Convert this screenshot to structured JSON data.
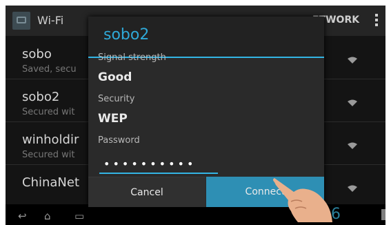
{
  "action_bar": {
    "title": "Wi-Fi",
    "add_network_label": "ETWORK",
    "overflow_icon": "overflow-menu-icon"
  },
  "networks": [
    {
      "ssid": "sobo",
      "status": "Saved, secu"
    },
    {
      "ssid": "sobo2",
      "status": "Secured wit"
    },
    {
      "ssid": "winholdir",
      "status": "Secured wit"
    },
    {
      "ssid": "ChinaNet",
      "status": ""
    }
  ],
  "dialog": {
    "title": "sobo2",
    "signal_label": "Signal strength",
    "signal_value": "Good",
    "security_label": "Security",
    "security_value": "WEP",
    "password_label": "Password",
    "password_value": "••••••••••",
    "cancel_label": "Cancel",
    "connect_label": "Connect"
  },
  "status": {
    "clock": "26"
  },
  "colors": {
    "accent": "#33b5e5",
    "connect_bg": "#2e8fb4",
    "background": "#141414"
  }
}
